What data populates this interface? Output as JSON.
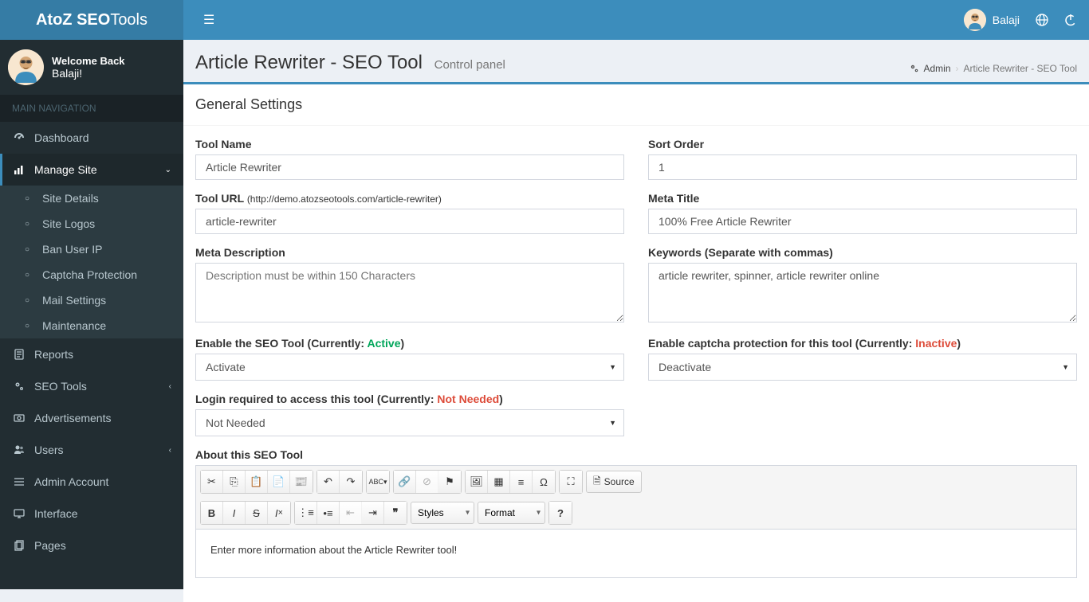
{
  "brand": {
    "a": "AtoZ SEO",
    "b": "Tools"
  },
  "header": {
    "username": "Balaji"
  },
  "sidebar": {
    "welcome": "Welcome Back",
    "username": "Balaji!",
    "section_label": "MAIN NAVIGATION",
    "items": [
      {
        "label": "Dashboard"
      },
      {
        "label": "Manage Site"
      },
      {
        "label": "Reports"
      },
      {
        "label": "SEO Tools"
      },
      {
        "label": "Advertisements"
      },
      {
        "label": "Users"
      },
      {
        "label": "Admin Account"
      },
      {
        "label": "Interface"
      },
      {
        "label": "Pages"
      }
    ],
    "manage_sub": [
      {
        "label": "Site Details"
      },
      {
        "label": "Site Logos"
      },
      {
        "label": "Ban User IP"
      },
      {
        "label": "Captcha Protection"
      },
      {
        "label": "Mail Settings"
      },
      {
        "label": "Maintenance"
      }
    ]
  },
  "page": {
    "title": "Article Rewriter - SEO Tool",
    "subtitle": "Control panel",
    "breadcrumb": {
      "admin": "Admin",
      "current": "Article Rewriter - SEO Tool"
    },
    "box_title": "General Settings"
  },
  "form": {
    "tool_name_label": "Tool Name",
    "tool_name_value": "Article Rewriter",
    "sort_order_label": "Sort Order",
    "sort_order_value": "1",
    "tool_url_label": "Tool URL",
    "tool_url_hint": "(http://demo.atozseotools.com/article-rewriter)",
    "tool_url_value": "article-rewriter",
    "meta_title_label": "Meta Title",
    "meta_title_value": "100% Free Article Rewriter",
    "meta_desc_label": "Meta Description",
    "meta_desc_placeholder": "Description must be within 150 Characters",
    "keywords_label": "Keywords (Separate with commas)",
    "keywords_value": "article rewriter, spinner, article rewriter online",
    "enable_tool_label": "Enable the SEO Tool (Currently: ",
    "enable_tool_status": "Active",
    "enable_tool_close": ")",
    "enable_tool_value": "Activate",
    "captcha_label": "Enable captcha protection for this tool (Currently: ",
    "captcha_status": "Inactive",
    "captcha_close": ")",
    "captcha_value": "Deactivate",
    "login_label": "Login required to access this tool (Currently: ",
    "login_status": "Not Needed",
    "login_close": ")",
    "login_value": "Not Needed",
    "about_label": "About this SEO Tool",
    "about_content": "Enter more information about the Article Rewriter tool!",
    "editor": {
      "source": "Source",
      "styles": "Styles",
      "format": "Format"
    }
  }
}
